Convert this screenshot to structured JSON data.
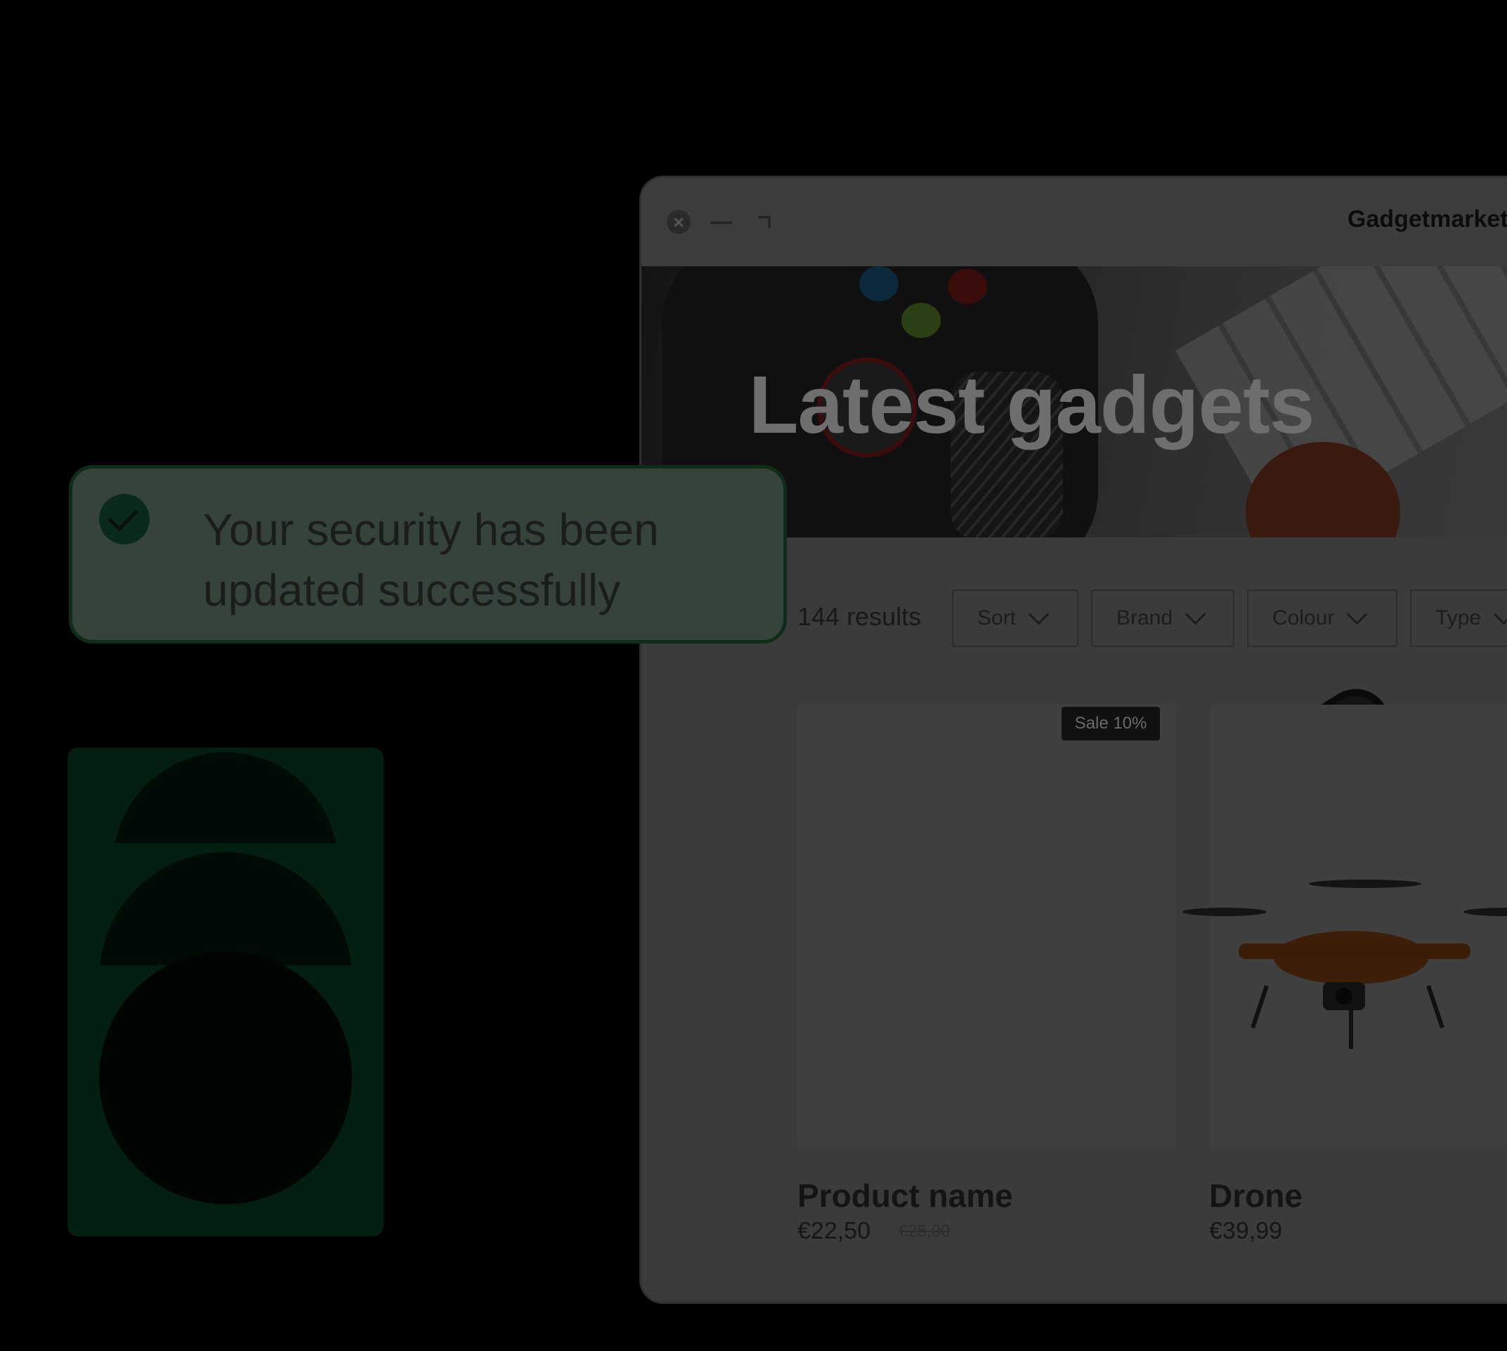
{
  "window": {
    "site_title": "Gadgetmarket",
    "controls": [
      "close-icon",
      "minimize-icon",
      "maximize-icon"
    ]
  },
  "hero": {
    "title": "Latest gadgets"
  },
  "filters": {
    "results": "144 results",
    "items": [
      {
        "label": "Sort"
      },
      {
        "label": "Brand"
      },
      {
        "label": "Colour"
      },
      {
        "label": "Type"
      }
    ]
  },
  "products": [
    {
      "name": "Product name",
      "price": "€22,50",
      "old_price": "€25,00",
      "badge": "Sale 10%"
    },
    {
      "name": "Drone",
      "price": "€39,99"
    }
  ],
  "toast": {
    "message": "Your security has been updated successfully",
    "icon": "check-circle-icon",
    "background": "#36433a",
    "border": "#0f2c17"
  },
  "colors": {
    "page_background": "#000000",
    "decor_panel": "#031f10"
  }
}
